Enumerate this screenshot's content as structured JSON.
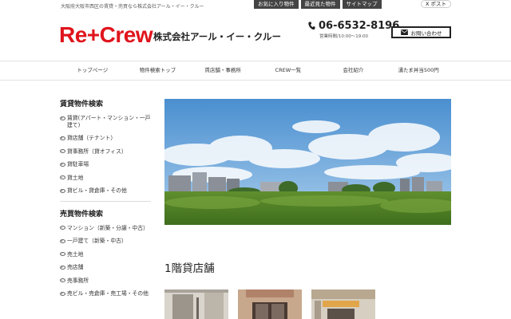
{
  "topbar": {
    "tagline": "大阪府大阪市西区の賃貸・売買なら株式会社アール・イー・クルー",
    "links": [
      "お気に入り物件",
      "最近見た物件",
      "サイトマップ"
    ],
    "xpost": "X ポスト"
  },
  "header": {
    "logo": "Re+Crew",
    "company": "株式会社アール・イー・クルー",
    "phone": "06-6532-8196",
    "hours": "営業時間/10:00〜19:00",
    "contact_label": "お問い合わせ"
  },
  "nav": [
    "トップページ",
    "物件検索トップ",
    "賃店舗・事務所",
    "CREW一覧",
    "会社紹介",
    "湧たま丼当500円"
  ],
  "sidebar": {
    "rent_heading": "賃貸物件検索",
    "rent_items": [
      "賃貸(アパート・マンション・一戸建て)",
      "貸店舗（テナント）",
      "貸事務所（貸オフィス）",
      "貸駐車場",
      "貸土地",
      "貸ビル・貸倉庫・その他"
    ],
    "sale_heading": "売買物件検索",
    "sale_items": [
      "マンション（新築・分譲・中古）",
      "一戸建て（新築・中古）",
      "売土地",
      "売店舗",
      "売事務所",
      "売ビル・売倉庫・売工場・その他"
    ]
  },
  "main": {
    "section_title": "1階貸店舗"
  },
  "colors": {
    "brand": "#e0141c",
    "dark_button": "#444444"
  }
}
